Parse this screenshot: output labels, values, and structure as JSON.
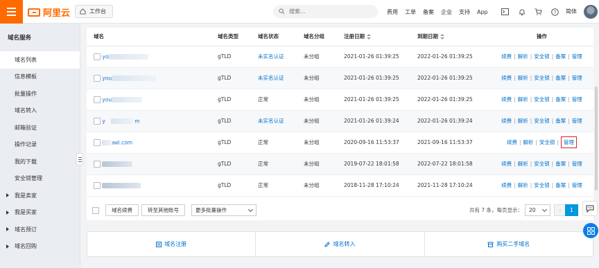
{
  "topbar": {
    "workbench_label": "工作台",
    "search_placeholder": "搜索...",
    "nav": [
      "费用",
      "工单",
      "备案",
      "企业",
      "支持",
      "App"
    ],
    "lang": "简体",
    "icons": [
      "terminal-icon",
      "bell-icon",
      "cart-icon",
      "help-icon"
    ],
    "brand_color": "#ff6a00"
  },
  "logo": {
    "text": "阿里云"
  },
  "sidebar": {
    "title": "域名服务",
    "items": [
      {
        "label": "域名列表"
      },
      {
        "label": "信息模板"
      },
      {
        "label": "批量操作"
      },
      {
        "label": "域名转入"
      },
      {
        "label": "邮箱验证"
      },
      {
        "label": "操作记录"
      },
      {
        "label": "我的下载"
      },
      {
        "label": "安全锁管理"
      },
      {
        "label": "我是卖家"
      },
      {
        "label": "我是买家"
      },
      {
        "label": "域名预订"
      },
      {
        "label": "域名回购"
      }
    ]
  },
  "table": {
    "headers": {
      "domain": "域名",
      "type": "域名类型",
      "status": "域名状态",
      "group": "域名分组",
      "reg": "注册日期",
      "exp": "到期日期",
      "ops": "操作"
    },
    "ops_labels": {
      "renew": "续费",
      "dns": "解析",
      "lock": "安全锁",
      "note": "备案",
      "manage": "管理"
    },
    "rows": [
      {
        "domain": "yo",
        "type": "gTLD",
        "status": "未实名认证",
        "group": "未分组",
        "reg": "2021-01-26 01:39:25",
        "exp": "2022-01-26 01:39:25"
      },
      {
        "domain": "you",
        "type": "gTLD",
        "status": "未实名认证",
        "group": "未分组",
        "reg": "2021-01-26 01:39:25",
        "exp": "2022-01-26 01:39:25"
      },
      {
        "domain": "you",
        "type": "gTLD",
        "status": "正常",
        "group": "未分组",
        "reg": "2021-01-26 01:39:25",
        "exp": "2022-01-26 01:39:25"
      },
      {
        "domain": "y",
        "domain_tail": "m",
        "type": "gTLD",
        "status": "未实名认证",
        "group": "未分组",
        "reg": "2021-01-26 01:39:24",
        "exp": "2022-01-26 01:39:24"
      },
      {
        "domain": "ael.com",
        "type": "gTLD",
        "status": "正常",
        "group": "未分组",
        "reg": "2020-09-16 11:53:37",
        "exp": "2021-09-16 11:53:37"
      },
      {
        "domain": "",
        "type": "gTLD",
        "status": "正常",
        "group": "未分组",
        "reg": "2019-07-22 18:01:58",
        "exp": "2022-07-22 18:01:58"
      },
      {
        "domain": "",
        "type": "gTLD",
        "status": "正常",
        "group": "未分组",
        "reg": "2018-11-28 17:10:24",
        "exp": "2021-11-28 17:10:24"
      }
    ]
  },
  "footer": {
    "renew_btn": "域名续费",
    "transfer_btn": "转至其他账号",
    "batch_select": "更多批量操作",
    "pager_text": "共有 7 条，每页显示：",
    "page_size": "20",
    "current_page": "1",
    "prev": "‹"
  },
  "actions": [
    {
      "label": "域名注册",
      "icon": "domain-register-icon"
    },
    {
      "label": "域名转入",
      "icon": "edit-icon"
    },
    {
      "label": "购买二手域名",
      "icon": "shop-icon"
    }
  ]
}
